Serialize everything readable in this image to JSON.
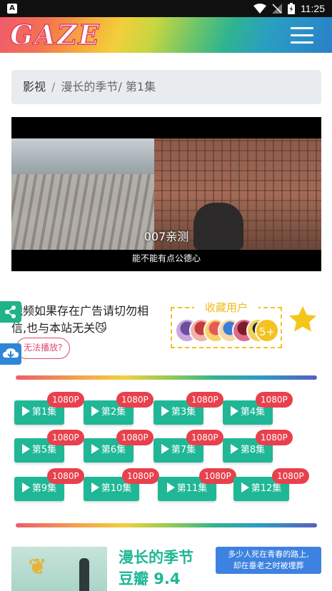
{
  "status_bar": {
    "time": "11:25"
  },
  "header": {
    "logo": "GAZE"
  },
  "breadcrumb": {
    "root": "影视",
    "separator": "/",
    "current": "漫长的季节/ 第1集"
  },
  "video": {
    "watermark": "007亲测",
    "subtitle": "能不能有点公德心"
  },
  "notice": {
    "text": "视频如果存在广告请切勿相信,也与本站无关😼",
    "cant_play": "无法播放?"
  },
  "favorites": {
    "title": "收藏用户",
    "count": "5+"
  },
  "episodes": [
    {
      "label": "第1集",
      "quality": "1080P"
    },
    {
      "label": "第2集",
      "quality": "1080P"
    },
    {
      "label": "第3集",
      "quality": "1080P"
    },
    {
      "label": "第4集",
      "quality": "1080P"
    },
    {
      "label": "第5集",
      "quality": "1080P"
    },
    {
      "label": "第6集",
      "quality": "1080P"
    },
    {
      "label": "第7集",
      "quality": "1080P"
    },
    {
      "label": "第8集",
      "quality": "1080P"
    },
    {
      "label": "第9集",
      "quality": "1080P"
    },
    {
      "label": "第10集",
      "quality": "1080P"
    },
    {
      "label": "第11集",
      "quality": "1080P"
    },
    {
      "label": "第12集",
      "quality": "1080P"
    }
  ],
  "info": {
    "title": "漫长的季节",
    "score": "豆瓣 9.4",
    "quote_line1": "多少人死在青春的路上,",
    "quote_line2": "却在垂老之时被埋葬"
  },
  "colors": {
    "accent": "#1fb796",
    "badge": "#e8414d",
    "star": "#f5c518"
  }
}
